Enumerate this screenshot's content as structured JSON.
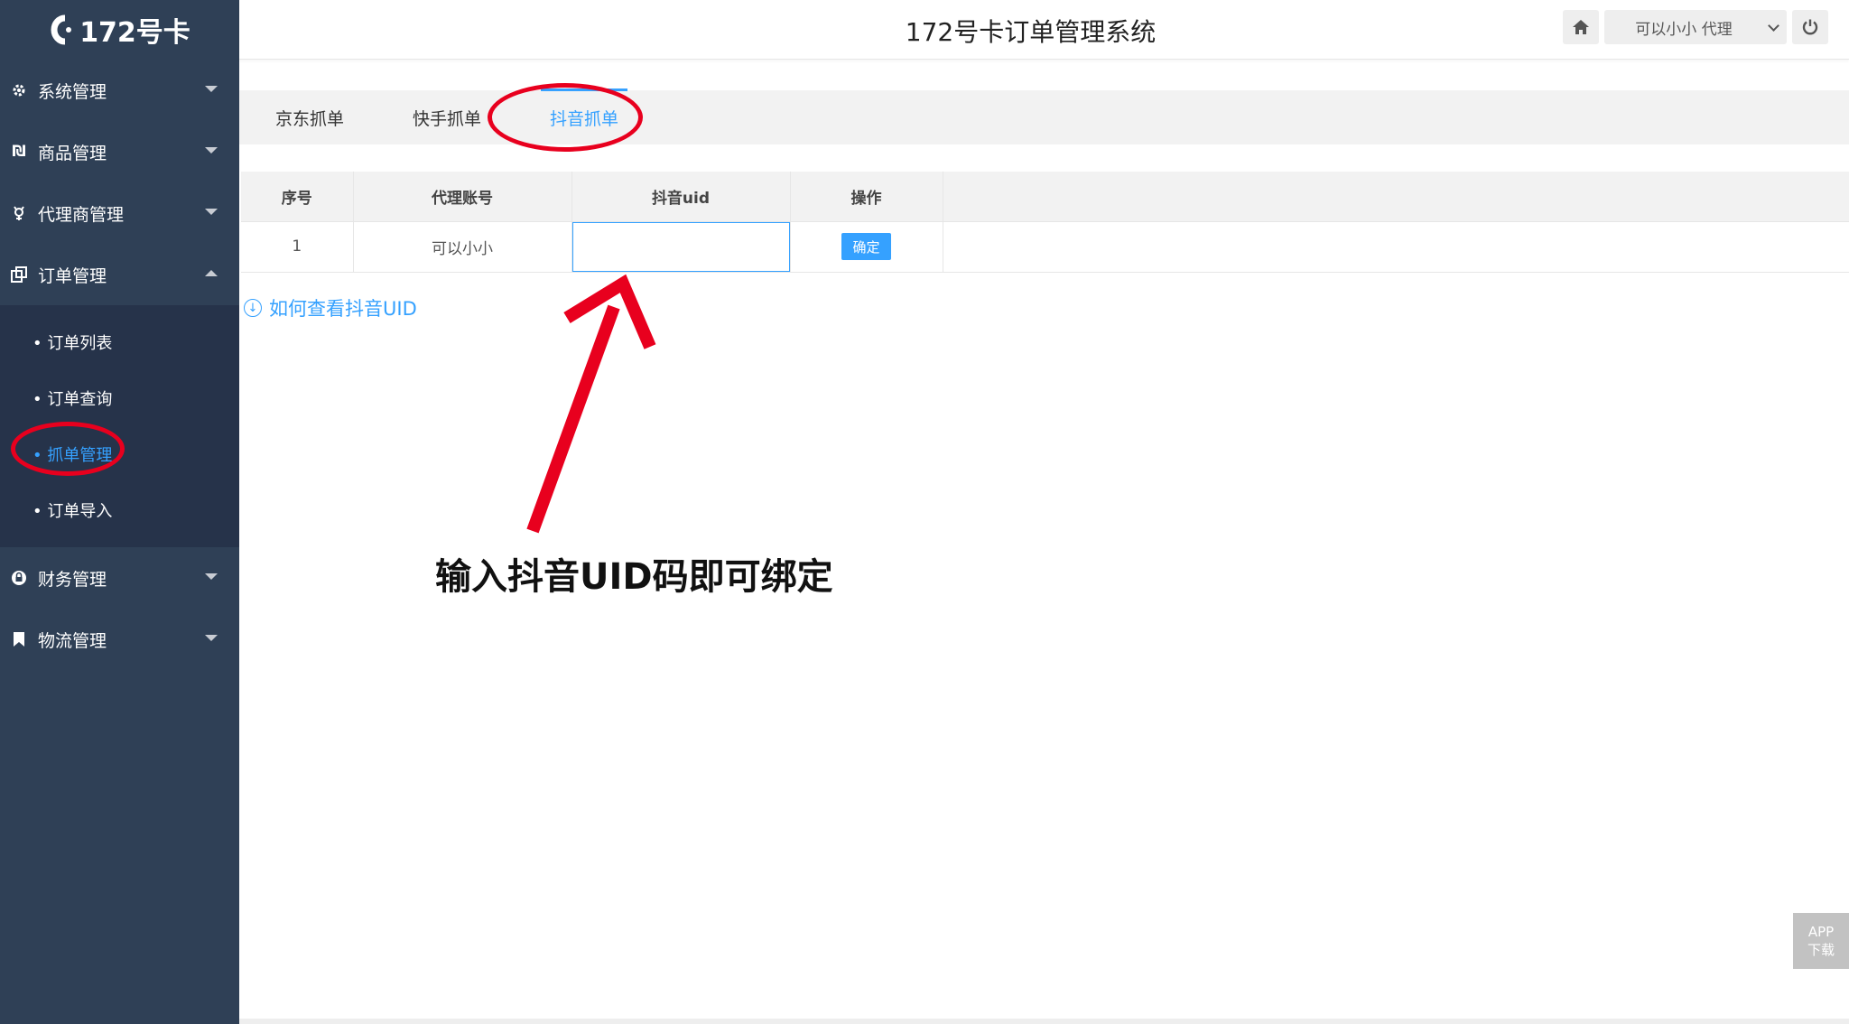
{
  "app": {
    "logo_text": "172号卡",
    "title": "172号卡订单管理系统"
  },
  "header": {
    "user_label": "可以小小 代理"
  },
  "sidebar": {
    "items": [
      {
        "label": "系统管理"
      },
      {
        "label": "商品管理"
      },
      {
        "label": "代理商管理"
      },
      {
        "label": "订单管理"
      },
      {
        "label": "财务管理"
      },
      {
        "label": "物流管理"
      }
    ],
    "order_submenu": [
      {
        "label": "• 订单列表"
      },
      {
        "label": "• 订单查询"
      },
      {
        "label": "• 抓单管理"
      },
      {
        "label": "• 订单导入"
      }
    ]
  },
  "tabs": [
    {
      "label": "京东抓单"
    },
    {
      "label": "快手抓单"
    },
    {
      "label": "抖音抓单"
    }
  ],
  "table": {
    "headers": [
      "序号",
      "代理账号",
      "抖音uid",
      "操作"
    ],
    "rows": [
      {
        "index": "1",
        "account": "可以小小",
        "uid": "",
        "action": "确定"
      }
    ]
  },
  "help_link": "如何查看抖音UID",
  "annotation": "输入抖音UID码即可绑定",
  "app_download": {
    "line1": "APP",
    "line2": "下载"
  },
  "colors": {
    "sidebar": "#2f4056",
    "accent": "#35a1ff",
    "annotation": "#e8001e"
  }
}
